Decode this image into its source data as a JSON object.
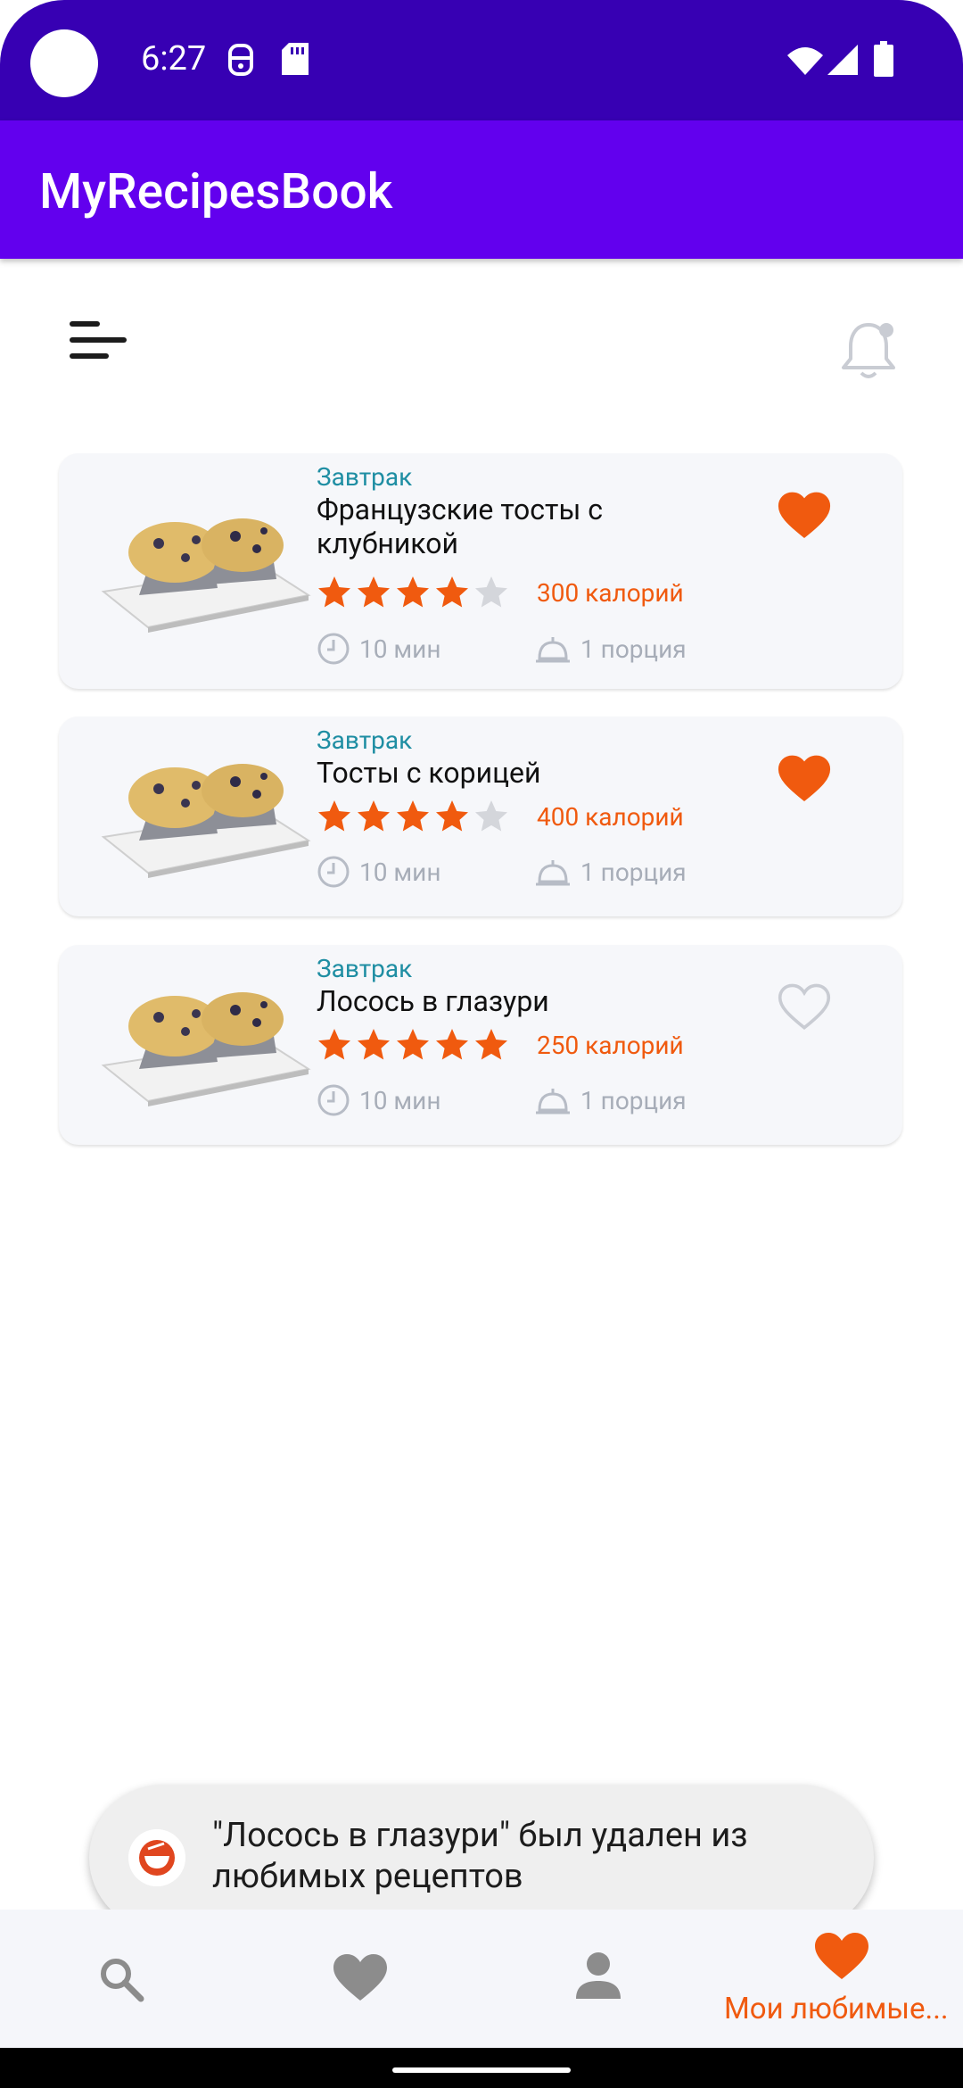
{
  "status_bar": {
    "time": "6:27"
  },
  "app": {
    "title": "MyRecipesBook"
  },
  "colors": {
    "accent": "#f05a0f",
    "category": "#1f8ea3",
    "appbar": "#6200ee",
    "statusbar": "#3700b3"
  },
  "recipes": [
    {
      "category": "Завтрак",
      "title": "Французские тосты с клубникой",
      "rating": 4,
      "calories": "300 калорий",
      "time": "10 мин",
      "servings": "1 порция",
      "favorite": true
    },
    {
      "category": "Завтрак",
      "title": "Тосты с корицей",
      "rating": 4,
      "calories": "400 калорий",
      "time": "10 мин",
      "servings": "1 порция",
      "favorite": true
    },
    {
      "category": "Завтрак",
      "title": "Лосось в глазури",
      "rating": 5,
      "calories": "250 калорий",
      "time": "10 мин",
      "servings": "1 порция",
      "favorite": false
    }
  ],
  "snackbar": {
    "text": "\"Лосось в глазури\" был удален из любимых рецептов"
  },
  "bottom_nav": {
    "items": [
      {
        "icon": "search-icon"
      },
      {
        "icon": "heart-icon"
      },
      {
        "icon": "person-icon"
      },
      {
        "icon": "heart-icon",
        "label": "Мои любимые...",
        "active": true
      }
    ]
  }
}
